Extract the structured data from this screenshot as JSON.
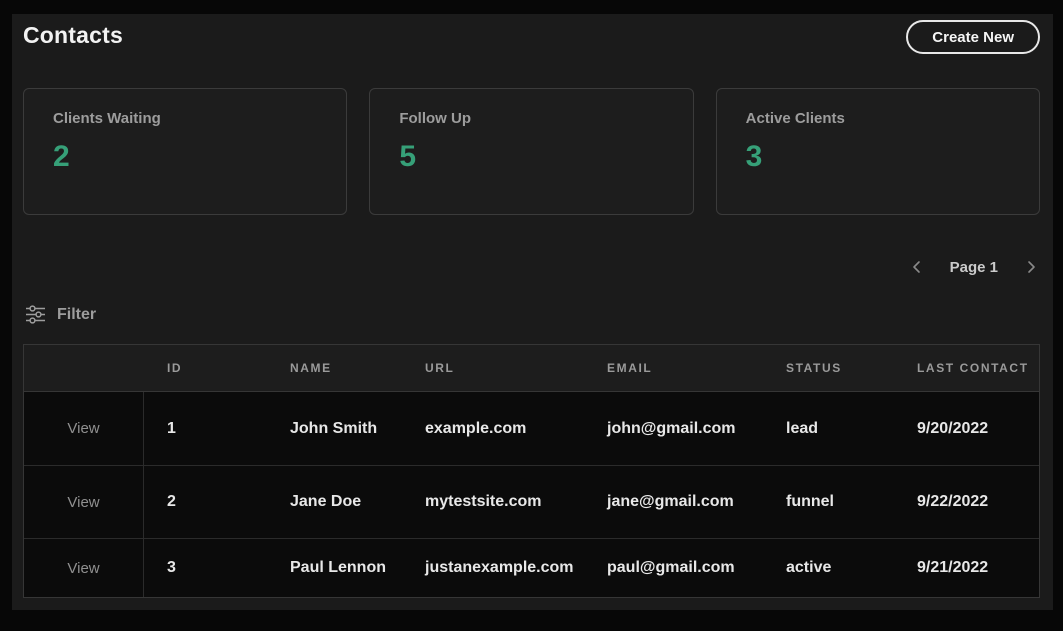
{
  "header": {
    "title": "Contacts",
    "create_button_label": "Create New"
  },
  "stats": {
    "cards": [
      {
        "label": "Clients Waiting",
        "value": "2"
      },
      {
        "label": "Follow Up",
        "value": "5"
      },
      {
        "label": "Active Clients",
        "value": "3"
      }
    ]
  },
  "pagination": {
    "label": "Page 1"
  },
  "filter": {
    "label": "Filter"
  },
  "table": {
    "columns": [
      "",
      "ID",
      "NAME",
      "URL",
      "EMAIL",
      "STATUS",
      "LAST CONTACT"
    ],
    "view_label": "View",
    "rows": [
      {
        "id": "1",
        "name": "John Smith",
        "url": "example.com",
        "email": "john@gmail.com",
        "status": "lead",
        "last_contact": "9/20/2022"
      },
      {
        "id": "2",
        "name": "Jane Doe",
        "url": "mytestsite.com",
        "email": "jane@gmail.com",
        "status": "funnel",
        "last_contact": "9/22/2022"
      },
      {
        "id": "3",
        "name": "Paul Lennon",
        "url": "justanexample.com",
        "email": "paul@gmail.com",
        "status": "active",
        "last_contact": "9/21/2022"
      }
    ]
  },
  "icons": {
    "filter": "sliders-icon",
    "prev": "chevron-left-icon",
    "next": "chevron-right-icon"
  },
  "colors": {
    "accent_green": "#36a078",
    "panel_bg": "#1b1b1b",
    "table_row_bg": "#0b0b0b",
    "frame_bg": "#070707",
    "muted_text": "#9d9d9d"
  }
}
